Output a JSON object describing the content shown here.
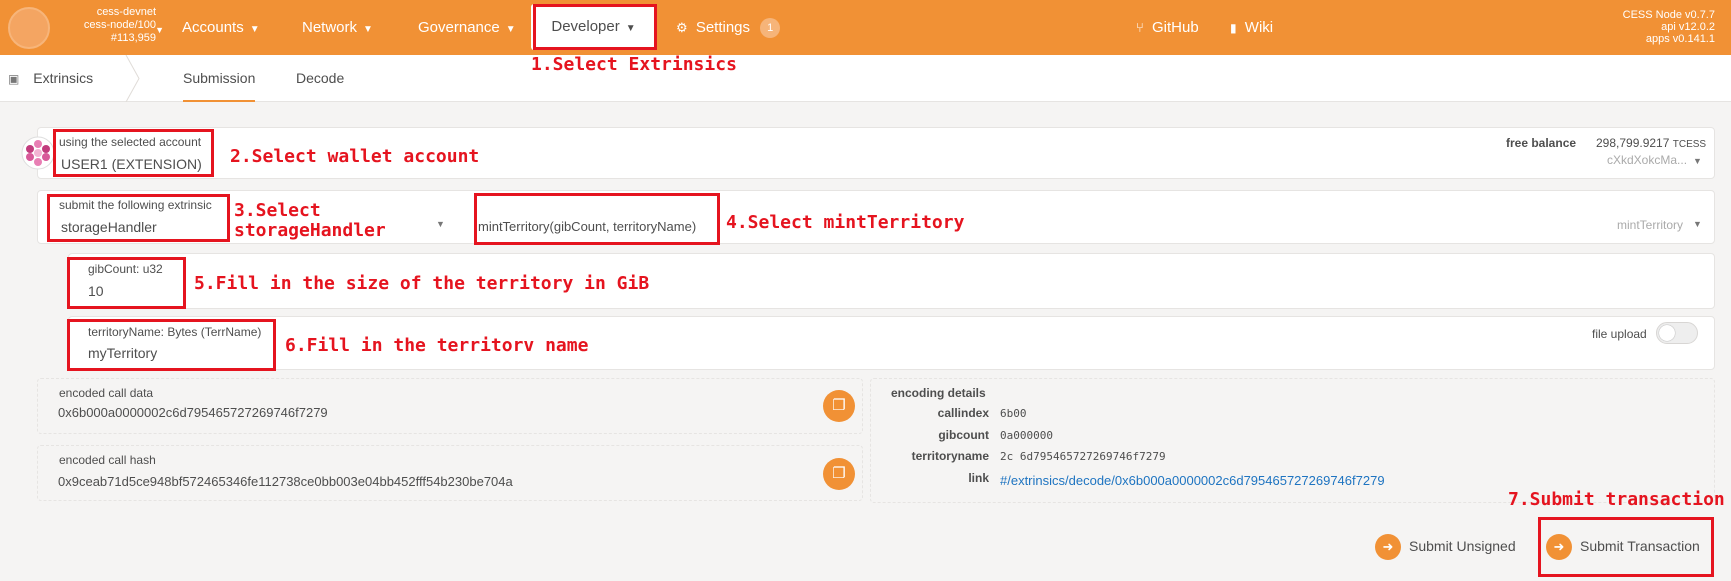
{
  "colors": {
    "accent": "#f19135",
    "annotation": "#e5141f",
    "link": "#1e74c1"
  },
  "header": {
    "chain_name": "cess-devnet",
    "node": "cess-node/100",
    "block": "#113,959",
    "nav": [
      {
        "label": "Accounts"
      },
      {
        "label": "Network"
      },
      {
        "label": "Governance"
      },
      {
        "label": "Developer"
      },
      {
        "label": "Settings",
        "badge": "1"
      }
    ],
    "links": [
      {
        "label": "GitHub",
        "icon": "github-icon"
      },
      {
        "label": "Wiki",
        "icon": "book-icon"
      }
    ],
    "version": [
      "CESS Node v0.7.7",
      "api v12.0.2",
      "apps v0.141.1"
    ]
  },
  "subnav": {
    "section": "Extrinsics",
    "tabs": [
      {
        "label": "Submission",
        "active": true
      },
      {
        "label": "Decode",
        "active": false
      }
    ]
  },
  "account": {
    "label": "using the selected account",
    "value": "USER1 (EXTENSION)",
    "balance_label": "free balance",
    "balance_value": "298,799.9217",
    "balance_unit": "TCESS",
    "address": "cXkdXokcMa..."
  },
  "extrinsic": {
    "label": "submit the following extrinsic",
    "module": "storageHandler",
    "call": "mintTerritory(gibCount, territoryName)",
    "call_short": "mintTerritory"
  },
  "params": [
    {
      "label": "gibCount: u32",
      "value": "10"
    },
    {
      "label": "territoryName: Bytes (TerrName)",
      "value": "myTerritory",
      "toggle_label": "file upload"
    }
  ],
  "encoded": {
    "call_data_label": "encoded call data",
    "call_data": "0x6b000a0000002c6d795465727269746f7279",
    "call_hash_label": "encoded call hash",
    "call_hash": "0x9ceab71d5ce948bf572465346fe112738ce0bb003e04bb452fff54b230be704a"
  },
  "details": {
    "title": "encoding details",
    "rows": [
      {
        "key": "callindex",
        "value": "6b00"
      },
      {
        "key": "gibcount",
        "value": "0a000000"
      },
      {
        "key": "territoryname",
        "value": "2c 6d795465727269746f7279"
      },
      {
        "key": "link",
        "value": "#/extrinsics/decode/0x6b000a0000002c6d795465727269746f7279"
      }
    ]
  },
  "actions": {
    "unsigned": "Submit Unsigned",
    "submit": "Submit Transaction"
  },
  "annotations": [
    "1.Select Extrinsics",
    "2.Select wallet account",
    "3.Select",
    "storageHandler",
    "4.Select mintTerritory",
    "5.Fill in the size of the territory in GiB",
    "6.Fill in the territorv name",
    "7.Submit transaction"
  ]
}
